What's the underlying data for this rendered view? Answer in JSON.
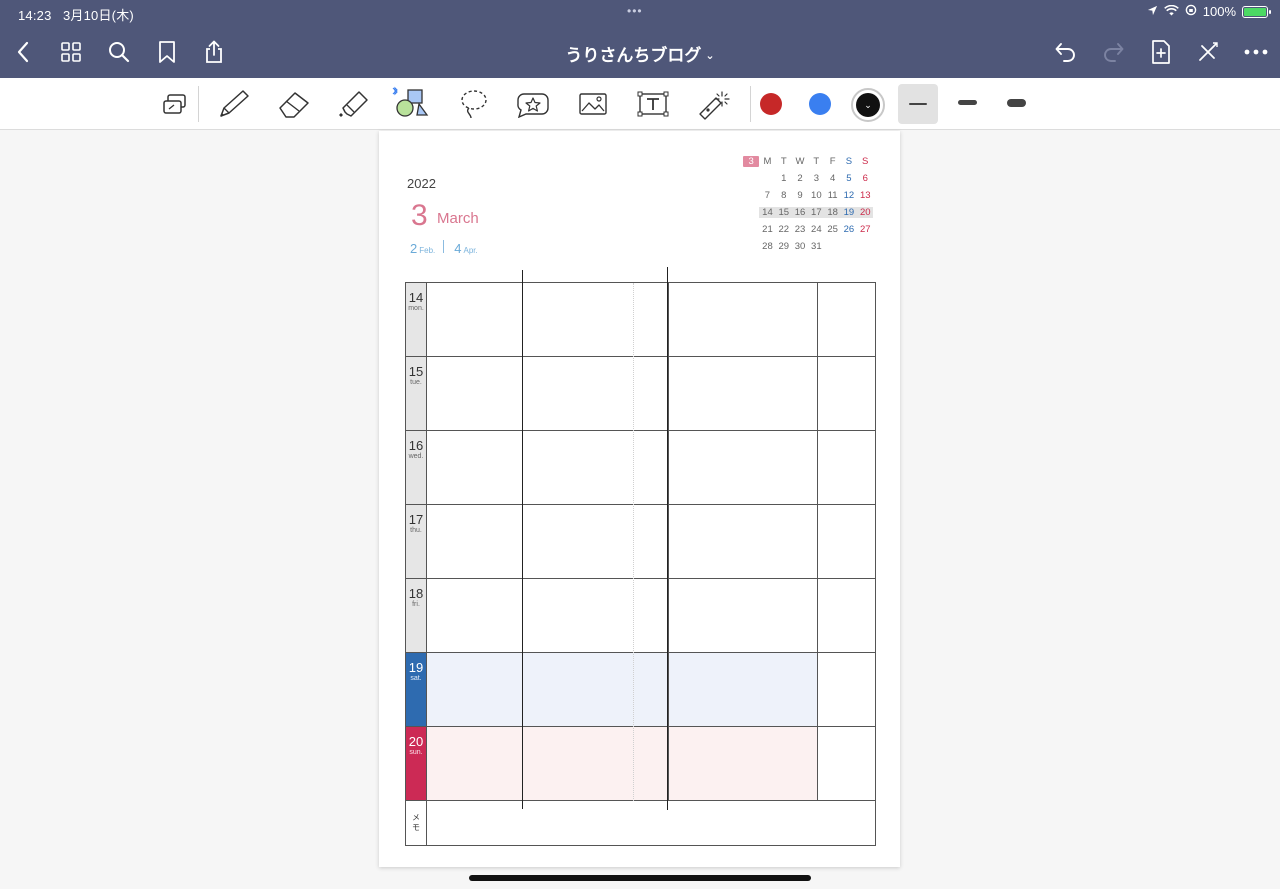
{
  "status": {
    "time": "14:23",
    "date": "3月10日(木)",
    "battery": "100%"
  },
  "nav": {
    "title": "うりさんちブログ",
    "title_chevron": "⌄"
  },
  "toolbar": {
    "colors": {
      "red": "#c62828",
      "blue": "#3a7ff0",
      "black": "#111111"
    },
    "selected_color_glyph": "⌄"
  },
  "page": {
    "year": "2022",
    "month_num": "3",
    "month_name": "March",
    "prev_month_num": "2",
    "prev_month_abbr": "Feb.",
    "next_month_num": "4",
    "next_month_abbr": "Apr."
  },
  "minical": {
    "month": "3",
    "headers": [
      "M",
      "T",
      "W",
      "T",
      "F",
      "S",
      "S"
    ],
    "weeks": [
      [
        "",
        "1",
        "2",
        "3",
        "4",
        "5",
        "6"
      ],
      [
        "7",
        "8",
        "9",
        "10",
        "11",
        "12",
        "13"
      ],
      [
        "14",
        "15",
        "16",
        "17",
        "18",
        "19",
        "20"
      ],
      [
        "21",
        "22",
        "23",
        "24",
        "25",
        "26",
        "27"
      ],
      [
        "28",
        "29",
        "30",
        "31",
        "",
        "",
        ""
      ]
    ],
    "highlight_week": 2
  },
  "days": [
    {
      "num": "14",
      "dow": "mon."
    },
    {
      "num": "15",
      "dow": "tue."
    },
    {
      "num": "16",
      "dow": "wed."
    },
    {
      "num": "17",
      "dow": "thu."
    },
    {
      "num": "18",
      "dow": "fri."
    },
    {
      "num": "19",
      "dow": "sat."
    },
    {
      "num": "20",
      "dow": "sun."
    }
  ],
  "memo_label": "メモ"
}
